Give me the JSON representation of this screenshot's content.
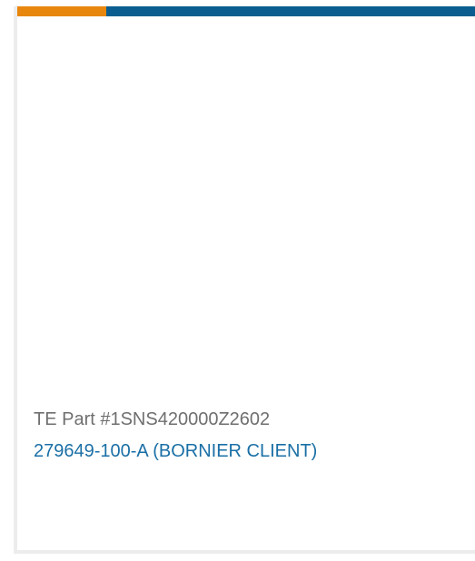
{
  "colors": {
    "accent_orange": "#e8870e",
    "accent_blue": "#0a5e8f",
    "link_blue": "#1a6fa5"
  },
  "product": {
    "part_number": "TE Part #1SNS420000Z2602",
    "name": "279649-100-A (BORNIER CLIENT)"
  }
}
